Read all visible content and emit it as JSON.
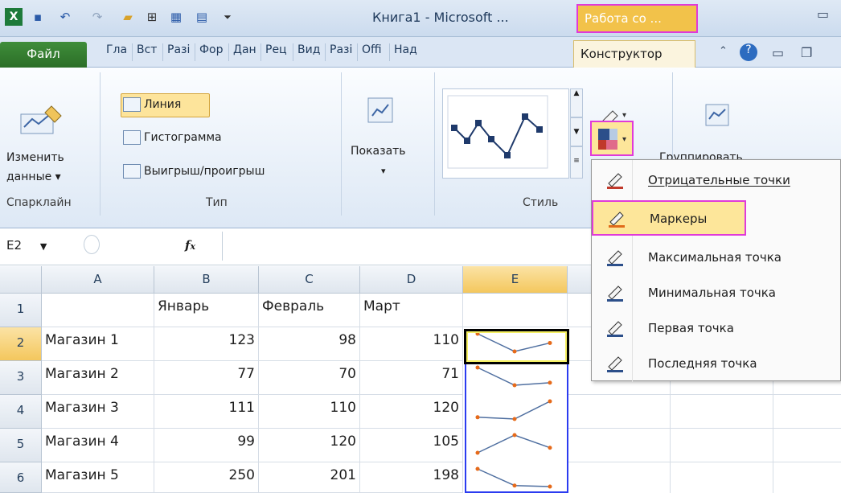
{
  "window": {
    "title": "Книга1 - Microsoft ...",
    "context_title": "Работа со ..."
  },
  "tabs": {
    "file": "Файл",
    "items": [
      "Гла",
      "Вст",
      "Разі",
      "Фор",
      "Дан",
      "Рец",
      "Вид",
      "Разі",
      "Offi",
      "Над"
    ],
    "active": "Конструктор"
  },
  "ribbon": {
    "sparkline": {
      "edit_label_1": "Изменить",
      "edit_label_2": "данные ▾",
      "group": "Спарклайн"
    },
    "type": {
      "line": "Линия",
      "column": "Гистограмма",
      "winloss": "Выигрыш/проигрыш",
      "group": "Тип"
    },
    "show": {
      "label": "Показать",
      "arrow": "▾"
    },
    "style": {
      "group": "Стиль"
    },
    "group_btn": {
      "label": "Группировать"
    }
  },
  "formula_bar": {
    "name_box": "E2",
    "fx": "fx",
    "value": ""
  },
  "grid": {
    "columns": [
      "A",
      "B",
      "C",
      "D",
      "E"
    ],
    "rows": [
      "1",
      "2",
      "3",
      "4",
      "5",
      "6"
    ],
    "header_row": [
      "",
      "Январь",
      "Февраль",
      "Март",
      ""
    ],
    "data": [
      {
        "store": "Магазин 1",
        "values": [
          123,
          98,
          110
        ]
      },
      {
        "store": "Магазин 2",
        "values": [
          77,
          70,
          71
        ]
      },
      {
        "store": "Магазин 3",
        "values": [
          111,
          110,
          120
        ]
      },
      {
        "store": "Магазин 4",
        "values": [
          99,
          120,
          105
        ]
      },
      {
        "store": "Магазин 5",
        "values": [
          250,
          201,
          198
        ]
      }
    ],
    "selected_cell": "E2"
  },
  "marker_menu": {
    "items": [
      {
        "label": "Отрицательные точки",
        "accent": "#c0392b"
      },
      {
        "label": "Маркеры",
        "accent": "#e06a1a",
        "highlighted": true
      },
      {
        "label": "Максимальная точка",
        "accent": "#2c4f8a"
      },
      {
        "label": "Минимальная точка",
        "accent": "#2c4f8a"
      },
      {
        "label": "Первая точка",
        "accent": "#2c4f8a"
      },
      {
        "label": "Последняя точка",
        "accent": "#2c4f8a"
      }
    ]
  },
  "colors": {
    "sparkline_line": "#4f6fa0",
    "sparkline_marker": "#e66a1a",
    "highlight": "#fde69a",
    "context_tab": "#f2c24a",
    "file_tab": "#3f8e3a",
    "annotation": "#e03ad9"
  }
}
